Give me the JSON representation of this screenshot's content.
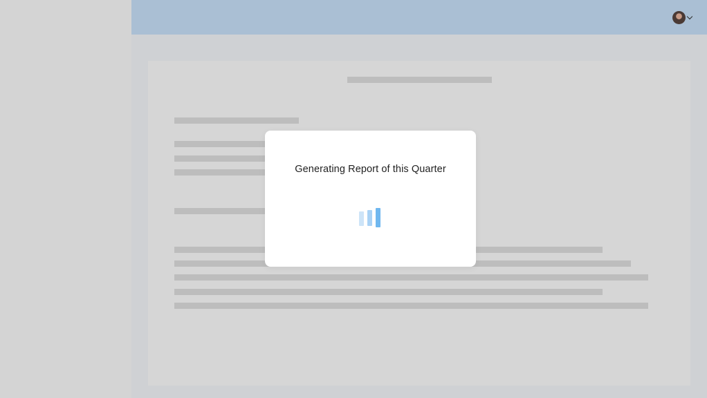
{
  "header": {
    "profile_icon": "user-avatar",
    "menu_icon": "chevron-down-icon"
  },
  "modal": {
    "title": "Generating Report of this Quarter",
    "loader_icon": "loading-bars-icon",
    "loader_colors": [
      "#cde4f8",
      "#a9d2f5",
      "#6fb7ef"
    ]
  },
  "colors": {
    "topbar": "#aabfd4",
    "overlay": "#cfd1d4",
    "modal_bg": "#ffffff"
  }
}
